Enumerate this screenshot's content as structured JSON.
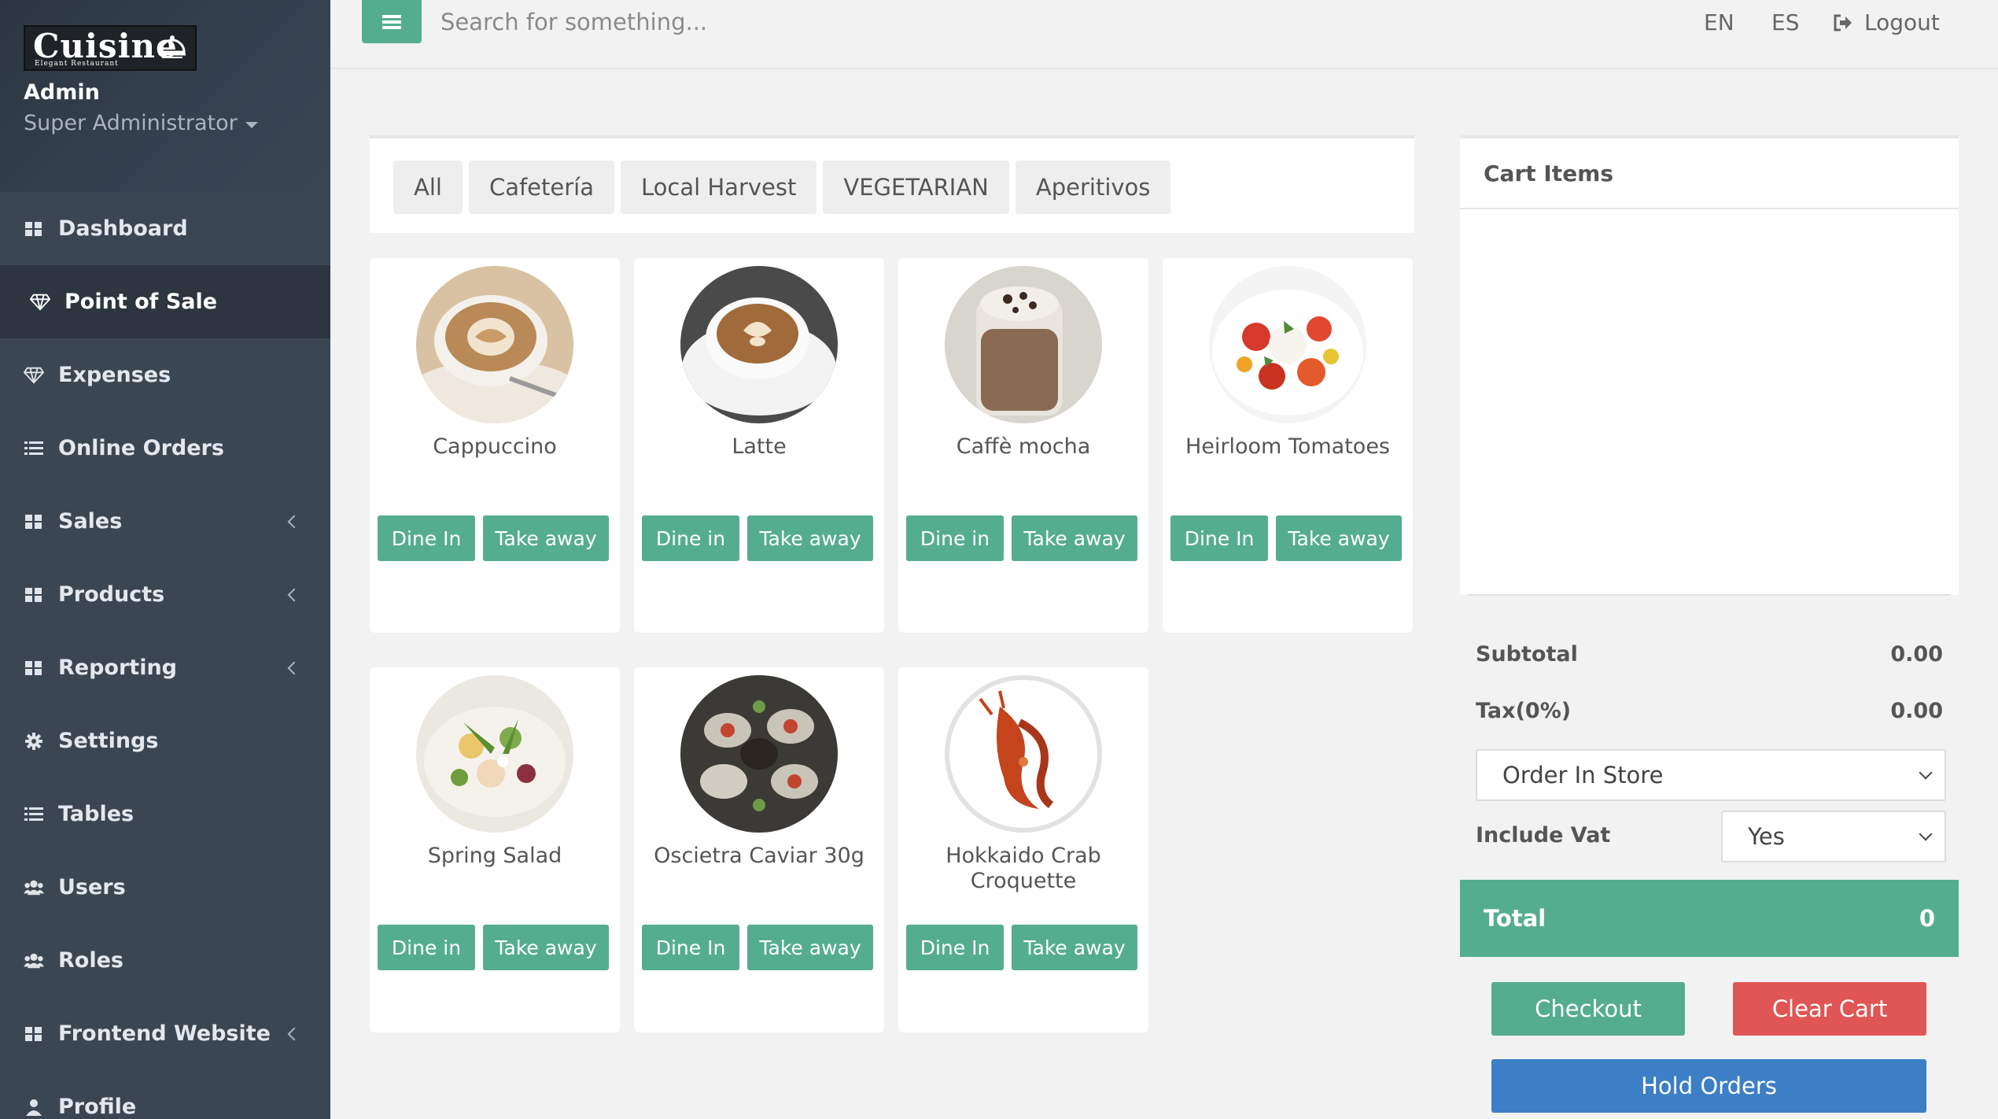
{
  "brand": {
    "word": "Cuisine",
    "tagline": "Elegant Restaurant"
  },
  "user": {
    "name": "Admin",
    "role": "Super Administrator"
  },
  "nav": [
    {
      "label": "Dashboard",
      "icon": "grid-icon"
    },
    {
      "label": "Point of Sale",
      "icon": "diamond-icon",
      "active": true
    },
    {
      "label": "Expenses",
      "icon": "diamond-icon"
    },
    {
      "label": "Online Orders",
      "icon": "list-icon"
    },
    {
      "label": "Sales",
      "icon": "grid-icon",
      "has_children": true
    },
    {
      "label": "Products",
      "icon": "grid-icon",
      "has_children": true
    },
    {
      "label": "Reporting",
      "icon": "grid-icon",
      "has_children": true
    },
    {
      "label": "Settings",
      "icon": "gear-icon"
    },
    {
      "label": "Tables",
      "icon": "list-icon"
    },
    {
      "label": "Users",
      "icon": "users-icon"
    },
    {
      "label": "Roles",
      "icon": "users-icon"
    },
    {
      "label": "Frontend Website",
      "icon": "grid-icon",
      "has_children": true
    },
    {
      "label": "Profile",
      "icon": "user-icon"
    }
  ],
  "topbar": {
    "search_placeholder": "Search for something...",
    "lang_en": "EN",
    "lang_es": "ES",
    "logout": "Logout"
  },
  "categories": [
    "All",
    "Cafetería",
    "Local Harvest",
    "VEGETARIAN",
    "Aperitivos"
  ],
  "products": [
    {
      "name": "Cappuccino",
      "dine": "Dine In",
      "take": "Take away"
    },
    {
      "name": "Latte",
      "dine": "Dine in",
      "take": "Take away"
    },
    {
      "name": "Caffè mocha",
      "dine": "Dine in",
      "take": "Take away"
    },
    {
      "name": "Heirloom Tomatoes",
      "dine": "Dine In",
      "take": "Take away"
    },
    {
      "name": "Spring Salad",
      "dine": "Dine in",
      "take": "Take away"
    },
    {
      "name": "Oscietra Caviar 30g",
      "dine": "Dine In",
      "take": "Take away"
    },
    {
      "name": "Hokkaido Crab Croquette",
      "dine": "Dine In",
      "take": "Take away"
    }
  ],
  "cart": {
    "title": "Cart Items",
    "subtotal_label": "Subtotal",
    "subtotal": "0.00",
    "tax_label": "Tax(0%)",
    "tax": "0.00",
    "order_type": "Order In Store",
    "include_vat_label": "Include Vat",
    "include_vat": "Yes",
    "total_label": "Total",
    "total": "0",
    "checkout": "Checkout",
    "clear": "Clear Cart",
    "hold": "Hold Orders"
  },
  "colors": {
    "accent": "#55ad8f",
    "danger": "#e05656",
    "primary": "#3d7fc6",
    "sidebar": "#3b4653"
  }
}
